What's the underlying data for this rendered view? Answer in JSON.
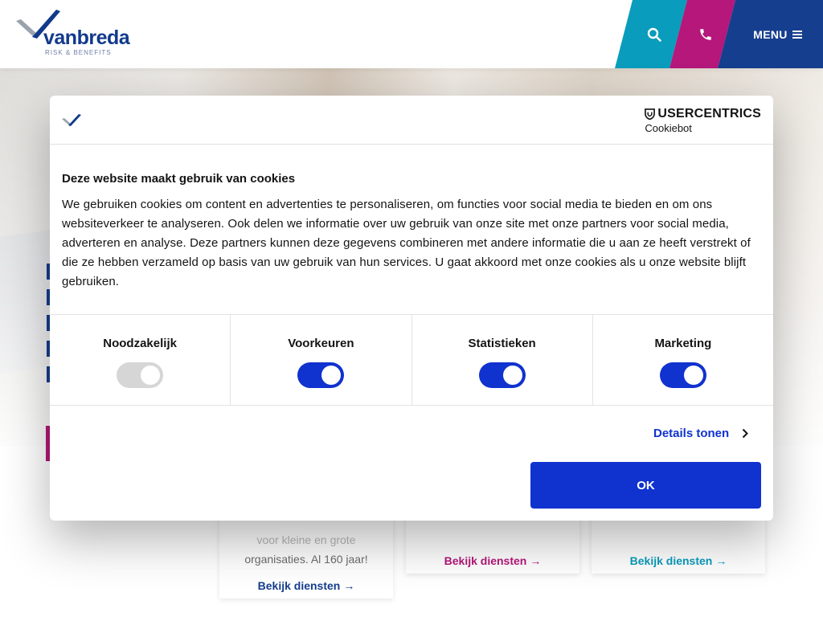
{
  "header": {
    "logo_word": "vanbreda",
    "logo_tagline": "RISK & BENEFITS",
    "search_icon": "search-icon",
    "phone_icon": "phone-icon",
    "menu_label": "MENU",
    "colors": {
      "search": "#0a9cbc",
      "phone": "#b5177a",
      "menu": "#163e8e"
    }
  },
  "cards": [
    {
      "text_faded": "voor kleine en grote",
      "text": "organisaties. Al 160 jaar!",
      "link": "Bekijk diensten",
      "color": "#163e8e"
    },
    {
      "link": "Bekijk diensten",
      "color": "#b5177a"
    },
    {
      "link": "Bekijk diensten",
      "color": "#0a9cbc"
    }
  ],
  "cookie_dialog": {
    "provider_name": "USERCENTRICS",
    "provider_product": "Cookiebot",
    "title": "Deze website maakt gebruik van cookies",
    "body": "We gebruiken cookies om content en advertenties te personaliseren, om functies voor social media te bieden en om ons websiteverkeer te analyseren. Ook delen we informatie over uw gebruik van onze site met onze partners voor social media, adverteren en analyse. Deze partners kunnen deze gegevens combineren met andere informatie die u aan ze heeft verstrekt of die ze hebben verzameld op basis van uw gebruik van hun services. U gaat akkoord met onze cookies als u onze website blijft gebruiken.",
    "toggles": [
      {
        "label": "Noodzakelijk",
        "checked": true,
        "disabled": true
      },
      {
        "label": "Voorkeuren",
        "checked": true,
        "disabled": false
      },
      {
        "label": "Statistieken",
        "checked": true,
        "disabled": false
      },
      {
        "label": "Marketing",
        "checked": true,
        "disabled": false
      }
    ],
    "details_label": "Details tonen",
    "ok_label": "OK",
    "accent_color": "#1032cf"
  }
}
